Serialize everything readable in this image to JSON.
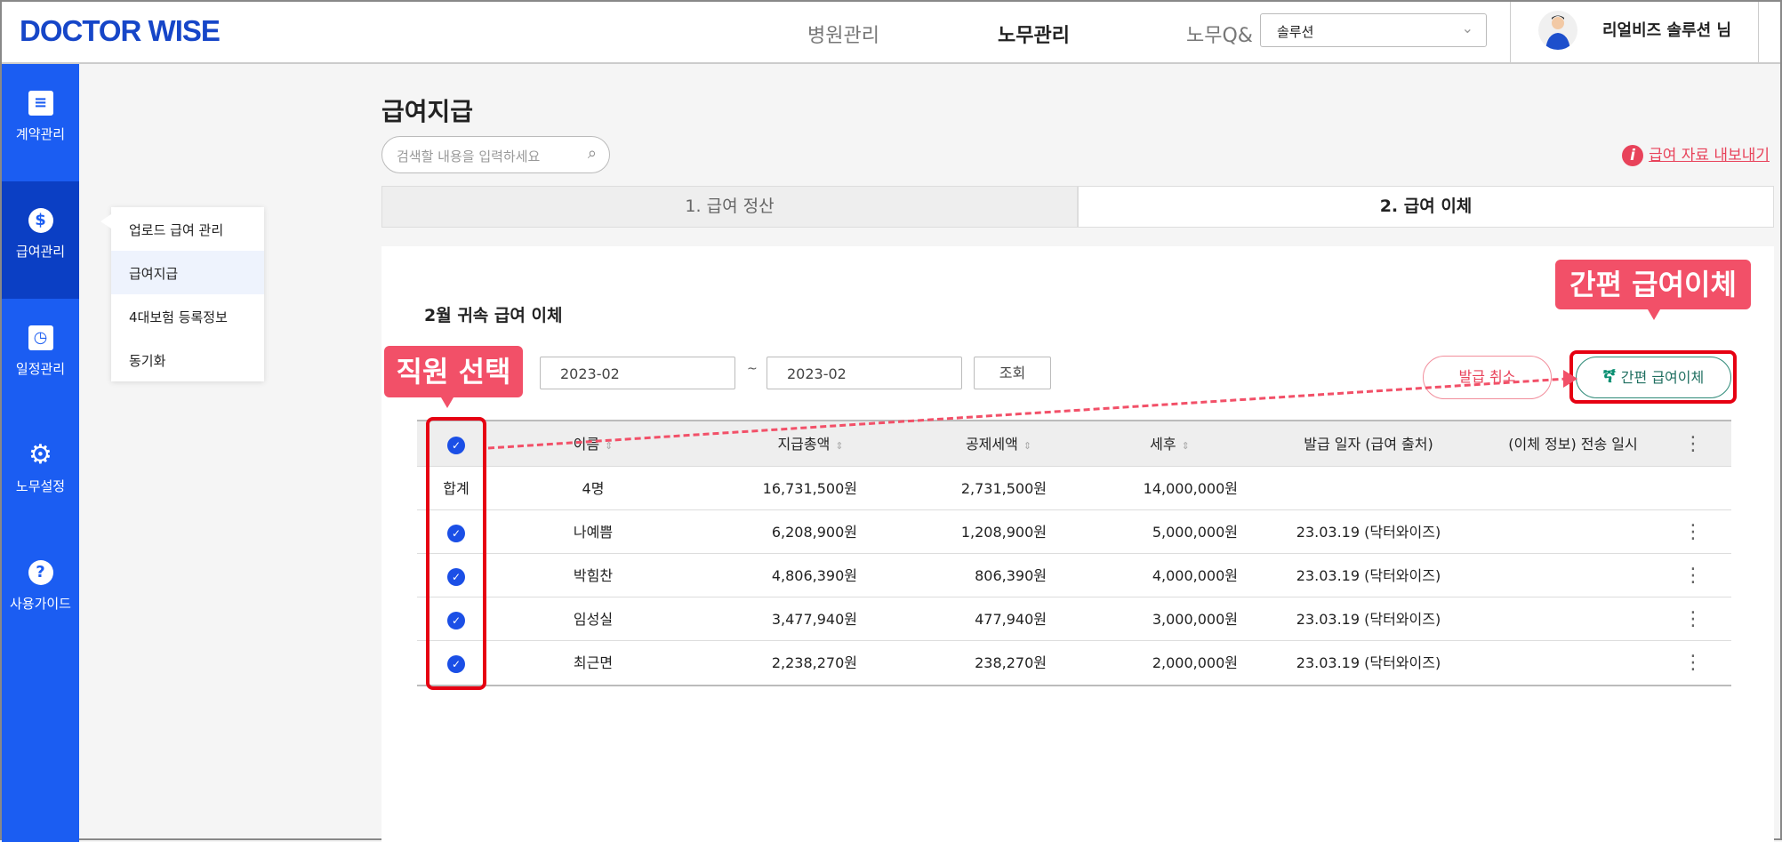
{
  "header": {
    "logo": "DOCTOR WISE",
    "nav": [
      "병원관리",
      "노무관리",
      "노무Q&"
    ],
    "solution_select": "솔루션",
    "user_name": "리얼비즈 솔루션 님"
  },
  "sidebar": {
    "items": [
      {
        "label": "계약관리",
        "icon": "document-icon"
      },
      {
        "label": "급여관리",
        "icon": "dollar-icon",
        "active": true
      },
      {
        "label": "일정관리",
        "icon": "calendar-icon"
      },
      {
        "label": "노무설정",
        "icon": "gear-icon"
      },
      {
        "label": "사용가이드",
        "icon": "help-icon"
      }
    ]
  },
  "submenu": {
    "items": [
      "업로드 급여 관리",
      "급여지급",
      "4대보험 등록정보",
      "동기화"
    ],
    "active": "급여지급"
  },
  "main": {
    "title": "급여지급",
    "search_placeholder": "검색할 내용을 입력하세요",
    "export_link": "급여 자료 내보내기",
    "tabs": [
      {
        "label": "1. 급여 정산"
      },
      {
        "label": "2. 급여 이체",
        "active": true
      }
    ],
    "section_title": "2월 귀속 급여 이체",
    "date_from": "2023-02",
    "tilde": "~",
    "date_to": "2023-02",
    "query_label": "조회",
    "cancel_label": "발급 취소",
    "transfer_label": "간편 급여이체",
    "table": {
      "headers": [
        "이름",
        "지급총액",
        "공제세액",
        "세후",
        "발급 일자 (급여 출처)",
        "(이체 정보) 전송 일시"
      ],
      "total": {
        "label": "합계",
        "count": "4명",
        "gross": "16,731,500원",
        "deduction": "2,731,500원",
        "net": "14,000,000원"
      },
      "rows": [
        {
          "name": "나예쁨",
          "gross": "6,208,900원",
          "deduction": "1,208,900원",
          "net": "5,000,000원",
          "issued": "23.03.19 (닥터와이즈)",
          "sent": "",
          "checked": true
        },
        {
          "name": "박힘찬",
          "gross": "4,806,390원",
          "deduction": "806,390원",
          "net": "4,000,000원",
          "issued": "23.03.19 (닥터와이즈)",
          "sent": "",
          "checked": true
        },
        {
          "name": "임성실",
          "gross": "3,477,940원",
          "deduction": "477,940원",
          "net": "3,000,000원",
          "issued": "23.03.19 (닥터와이즈)",
          "sent": "",
          "checked": true
        },
        {
          "name": "최근면",
          "gross": "2,238,270원",
          "deduction": "238,270원",
          "net": "2,000,000원",
          "issued": "23.03.19 (닥터와이즈)",
          "sent": "",
          "checked": true
        }
      ]
    }
  },
  "annotations": {
    "select_callout": "직원 선택",
    "transfer_callout": "간편 급여이체",
    "color": "#f25068",
    "outline_color": "#e60012"
  }
}
